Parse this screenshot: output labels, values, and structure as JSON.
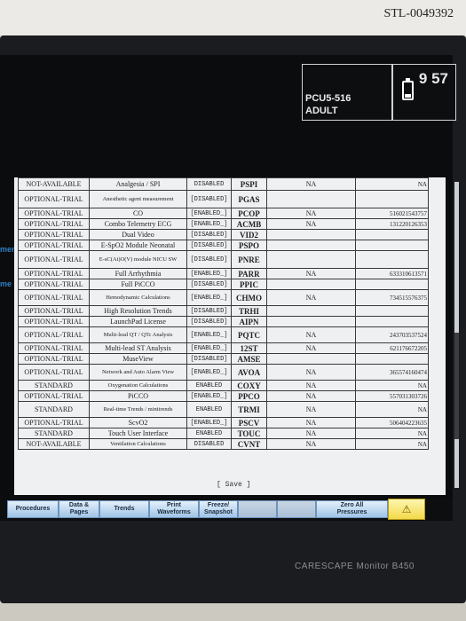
{
  "asset_tag": "STL-0049392",
  "patient": {
    "location": "PCU5-516",
    "category": "ADULT"
  },
  "time": "9 57",
  "left_edge_labels": [
    "ment",
    "me"
  ],
  "table": {
    "rows": [
      {
        "status": "NOT-AVAILABLE",
        "feature": "Analgesia / SPI",
        "state": "DISABLED",
        "code": "PSPI",
        "c5": "NA",
        "c6": "NA"
      },
      {
        "status": "OPTIONAL-TRIAL",
        "feature": "Anesthetic agent measurement",
        "state": "[DISABLED]",
        "code": "PGAS",
        "c5": "",
        "c6": ""
      },
      {
        "status": "OPTIONAL-TRIAL",
        "feature": "CO",
        "state": "[ENABLED_]",
        "code": "PCOP",
        "c5": "NA",
        "c6": "516021543757"
      },
      {
        "status": "OPTIONAL-TRIAL",
        "feature": "Combo Telemetry ECG",
        "state": "[ENABLED_]",
        "code": "ACMB",
        "c5": "NA",
        "c6": "131220126353"
      },
      {
        "status": "OPTIONAL-TRIAL",
        "feature": "Dual Video",
        "state": "[DISABLED]",
        "code": "VID2",
        "c5": "",
        "c6": ""
      },
      {
        "status": "OPTIONAL-TRIAL",
        "feature": "E-SpO2 Module Neonatal",
        "state": "[DISABLED]",
        "code": "PSPO",
        "c5": "",
        "c6": ""
      },
      {
        "status": "OPTIONAL-TRIAL",
        "feature": "E-sC(Ai)O(V) module NICU SW",
        "state": "[DISABLED]",
        "code": "PNRE",
        "c5": "",
        "c6": ""
      },
      {
        "status": "OPTIONAL-TRIAL",
        "feature": "Full Arrhythmia",
        "state": "[ENABLED_]",
        "code": "PARR",
        "c5": "NA",
        "c6": "633310613571"
      },
      {
        "status": "OPTIONAL-TRIAL",
        "feature": "Full PiCCO",
        "state": "[DISABLED]",
        "code": "PPIC",
        "c5": "",
        "c6": ""
      },
      {
        "status": "OPTIONAL-TRIAL",
        "feature": "Hemodynamic Calculations",
        "state": "[ENABLED_]",
        "code": "CHMO",
        "c5": "NA",
        "c6": "734515576375"
      },
      {
        "status": "OPTIONAL-TRIAL",
        "feature": "High Resolution Trends",
        "state": "[DISABLED]",
        "code": "TRHI",
        "c5": "",
        "c6": ""
      },
      {
        "status": "OPTIONAL-TRIAL",
        "feature": "LaunchPad License",
        "state": "[DISABLED]",
        "code": "AIPN",
        "c5": "",
        "c6": ""
      },
      {
        "status": "OPTIONAL-TRIAL",
        "feature": "Multi-lead QT / QTc Analysis",
        "state": "[ENABLED_]",
        "code": "PQTC",
        "c5": "NA",
        "c6": "243703537524"
      },
      {
        "status": "OPTIONAL-TRIAL",
        "feature": "Multi-lead ST Analysis",
        "state": "[ENABLED_]",
        "code": "12ST",
        "c5": "NA",
        "c6": "621176672205"
      },
      {
        "status": "OPTIONAL-TRIAL",
        "feature": "MuseView",
        "state": "[DISABLED]",
        "code": "AMSE",
        "c5": "",
        "c6": ""
      },
      {
        "status": "OPTIONAL-TRIAL",
        "feature": "Network and Auto Alarm View",
        "state": "[ENABLED_]",
        "code": "AVOA",
        "c5": "NA",
        "c6": "365574160474"
      },
      {
        "status": "STANDARD",
        "feature": "Oxygenation Calculations",
        "state": "ENABLED",
        "code": "COXY",
        "c5": "NA",
        "c6": "NA"
      },
      {
        "status": "OPTIONAL-TRIAL",
        "feature": "PiCCO",
        "state": "[ENABLED_]",
        "code": "PPCO",
        "c5": "NA",
        "c6": "557031303726"
      },
      {
        "status": "STANDARD",
        "feature": "Real-time Trends / minitrends",
        "state": "ENABLED",
        "code": "TRMI",
        "c5": "NA",
        "c6": "NA"
      },
      {
        "status": "OPTIONAL-TRIAL",
        "feature": "ScvO2",
        "state": "[ENABLED_]",
        "code": "PSCV",
        "c5": "NA",
        "c6": "506404223635"
      },
      {
        "status": "STANDARD",
        "feature": "Touch User Interface",
        "state": "ENABLED",
        "code": "TOUC",
        "c5": "NA",
        "c6": "NA"
      },
      {
        "status": "NOT-AVAILABLE",
        "feature": "Ventilation Calculations",
        "state": "DISABLED",
        "code": "CVNT",
        "c5": "NA",
        "c6": "NA"
      }
    ]
  },
  "save_label": "[ Save ]",
  "menu": {
    "procedures": "Procedures",
    "data_pages": "Data &\nPages",
    "trends": "Trends",
    "print_waveforms": "Print\nWaveforms",
    "freeze_snapshot": "Freeze/\nSnapshot",
    "zero_all": "Zero All\nPressures",
    "alarm_icon": "alarm-bell-icon"
  },
  "brand": "CARESCAPE Monitor B450"
}
